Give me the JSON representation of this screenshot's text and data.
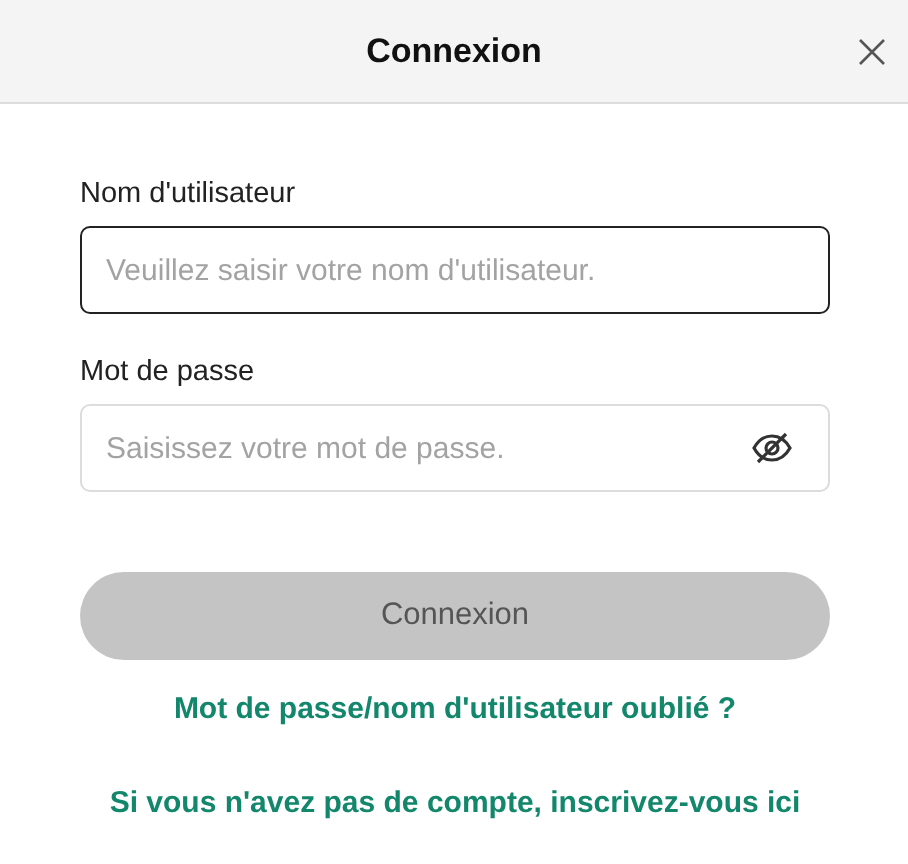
{
  "dialog": {
    "title": "Connexion"
  },
  "fields": [
    {
      "kind": "text",
      "label": "Nom d'utilisateur",
      "placeholder": "Veuillez saisir votre nom d'utilisateur.",
      "focused": true
    },
    {
      "kind": "password",
      "label": "Mot de passe",
      "placeholder": "Saisissez votre mot de passe.",
      "focused": false,
      "revealed": false
    }
  ],
  "submit": {
    "label": "Connexion",
    "disabled": true
  },
  "links": [
    "Mot de passe/nom d'utilisateur oublié ?",
    "Si vous n'avez pas de compte, inscrivez-vous ici"
  ]
}
